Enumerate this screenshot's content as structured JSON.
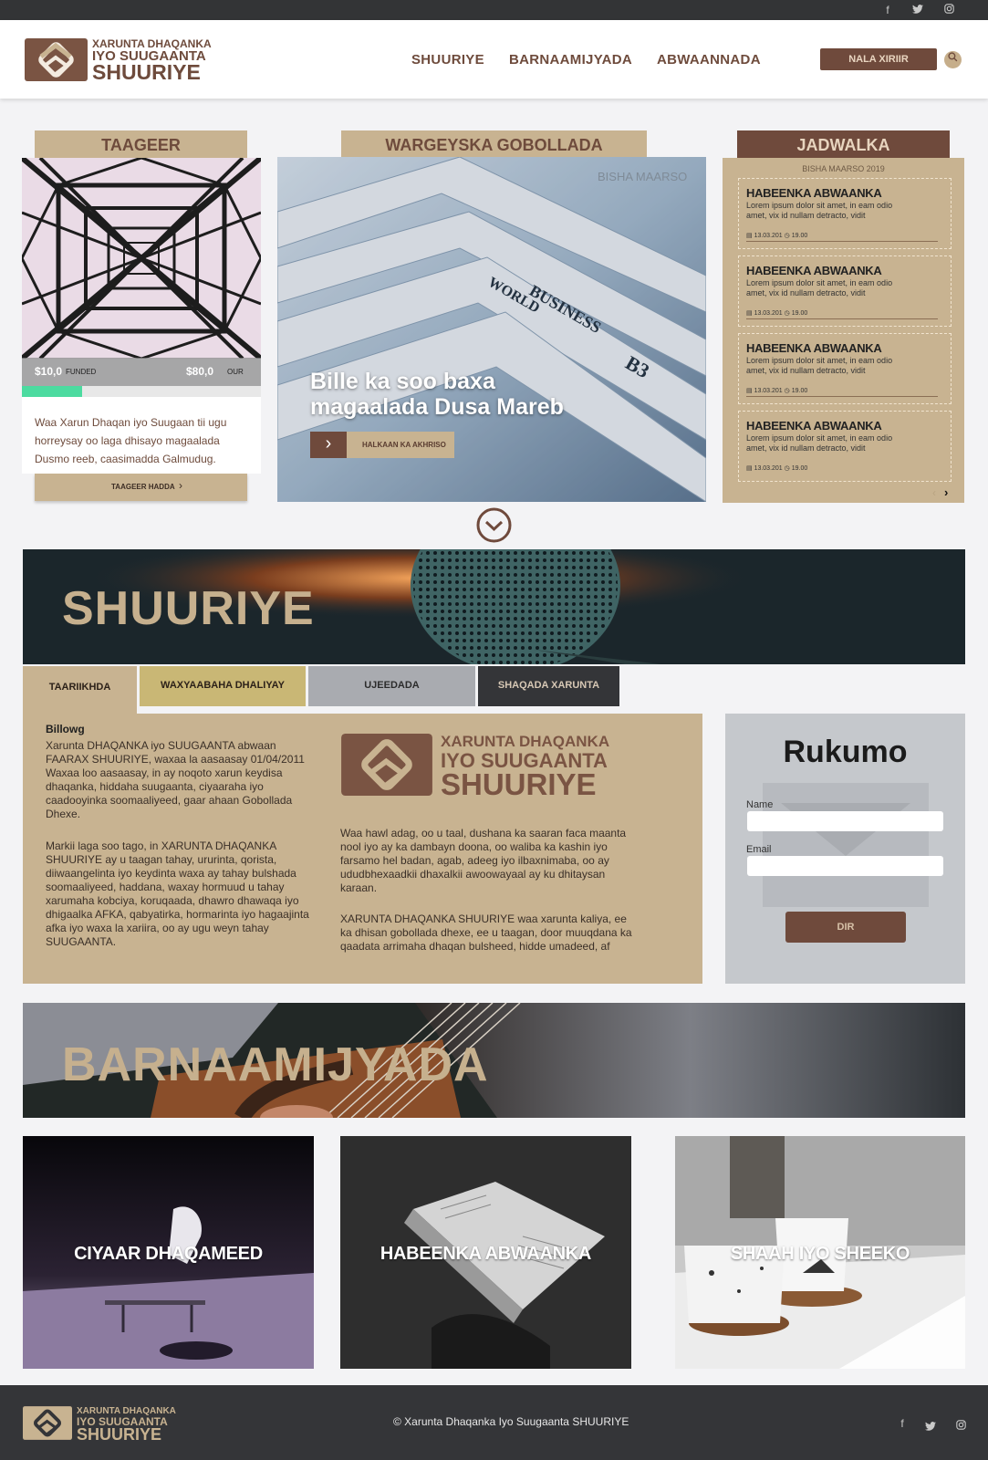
{
  "topbar": {
    "social": [
      "facebook-icon",
      "twitter-icon",
      "instagram-icon"
    ]
  },
  "brand": {
    "line1": "XARUNTA DHAQANKA",
    "line2": "IYO SUUGAANTA",
    "line3": "SHUURIYE"
  },
  "nav": {
    "items": [
      "SHUURIYE",
      "BARNAAMIJYADA",
      "ABWAANNADA"
    ],
    "contact_label": "NALA XIRIIR"
  },
  "support": {
    "title": "TAAGEER",
    "funded_amount": "$10,0",
    "funded_label": "FUNDED",
    "goal_amount": "$80,0",
    "goal_label": "OUR",
    "progress": 0.25,
    "description": "Waa Xarun Dhaqan iyo Suugaan tii ugu horreysay oo laga dhisayo magaalada Dusmo reeb, caasimadda Galmudug.",
    "button_label": "TAAGEER HADDA"
  },
  "news": {
    "title": "WARGEYSKA GOBOLLADA",
    "month": "BISHA MAARSO",
    "headline": "Bille ka soo baxa magaalada Dusa Mareb",
    "read_label": "HALKAAN KA AKHRISO",
    "photo_text": [
      "WORLD",
      "BUSINESS",
      "B3"
    ]
  },
  "schedule": {
    "title": "JADWALKA",
    "month": "BISHA MAARSO 2019",
    "items": [
      {
        "title": "HABEENKA ABWAANKA",
        "desc": "Lorem ipsum dolor sit amet, in eam odio amet, vix id nullam detracto, vidit",
        "date": "13.03.201",
        "time": "19.00"
      },
      {
        "title": "HABEENKA ABWAANKA",
        "desc": "Lorem ipsum dolor sit amet, in eam odio amet, vix id nullam detracto, vidit",
        "date": "13.03.201",
        "time": "19.00"
      },
      {
        "title": "HABEENKA ABWAANKA",
        "desc": "Lorem ipsum dolor sit amet, in eam odio amet, vix id nullam detracto, vidit",
        "date": "13.03.201",
        "time": "19.00"
      },
      {
        "title": "HABEENKA ABWAANKA",
        "desc": "Lorem ipsum dolor sit amet, in eam odio amet, vix id nullam detracto, vidit",
        "date": "13.03.201",
        "time": "19.00"
      }
    ]
  },
  "about": {
    "banner_title": "SHUURIYE",
    "tabs": [
      "TAARIIKHDA",
      "WAXYAABAHA DHALIYAY",
      "UJEEDADA",
      "SHAQADA XARUNTA"
    ],
    "heading": "Billowg",
    "para1": "Xarunta DHAQANKA iyo SUUGAANTA abwaan FAARAX SHUURIYE, waxaa la aasaasay 01/04/2011 Waxaa loo aasaasay, in ay noqoto xarun keydisa dhaqanka, hiddaha suugaanta, ciyaaraha iyo caadooyinka soomaaliyeed, gaar ahaan Gobollada Dhexe.",
    "para2": "Markii laga soo tago, in XARUNTA DHAQANKA SHUURIYE ay u taagan tahay, ururinta, qorista, diiwaangelinta iyo keydinta waxa ay tahay bulshada soomaaliyeed, haddana, waxay hormuud u tahay xarumaha kobciya, koruqaada, dhawro dhawaqa iyo dhigaalka AFKA, qabyatirka, hormarinta iyo hagaajinta afka iyo waxa la xariira, oo ay ugu weyn tahay SUUGAANTA.",
    "para3": "Waa hawl adag, oo u taal, dushana ka saaran faca maanta nool iyo ay ka dambayn doona, oo waliba ka kashin iyo farsamo hel badan, agab, adeeg iyo ilbaxnimaba, oo ay ududbhexaadkii dhaxalkii awoowayaal ay ku dhitaysan karaan.",
    "para4": "XARUNTA DHAQANKA SHUURIYE waa xarunta kaliya, ee ka dhisan gobollada dhexe, ee u taagan, door muuqdana ka qaadata arrimaha dhaqan bulsheed, hidde umadeed, af"
  },
  "signup": {
    "title": "Rukumo",
    "name_label": "Name",
    "email_label": "Email",
    "button_label": "DIR"
  },
  "programs": {
    "banner_title": "BARNAAMIJYADA",
    "items": [
      "CIYAAR DHAQAMEED",
      "HABEENKA ABWAANKA",
      "SHAAH IYO SHEEKO"
    ]
  },
  "footer": {
    "copyright": "© Xarunta Dhaqanka Iyo Suugaanta SHUURIYE",
    "social": [
      "facebook-icon",
      "twitter-icon",
      "instagram-icon"
    ]
  },
  "colors": {
    "brown": "#6f4a3c",
    "tan": "#c8b391",
    "dark": "#333436",
    "green": "#4cdba0"
  }
}
